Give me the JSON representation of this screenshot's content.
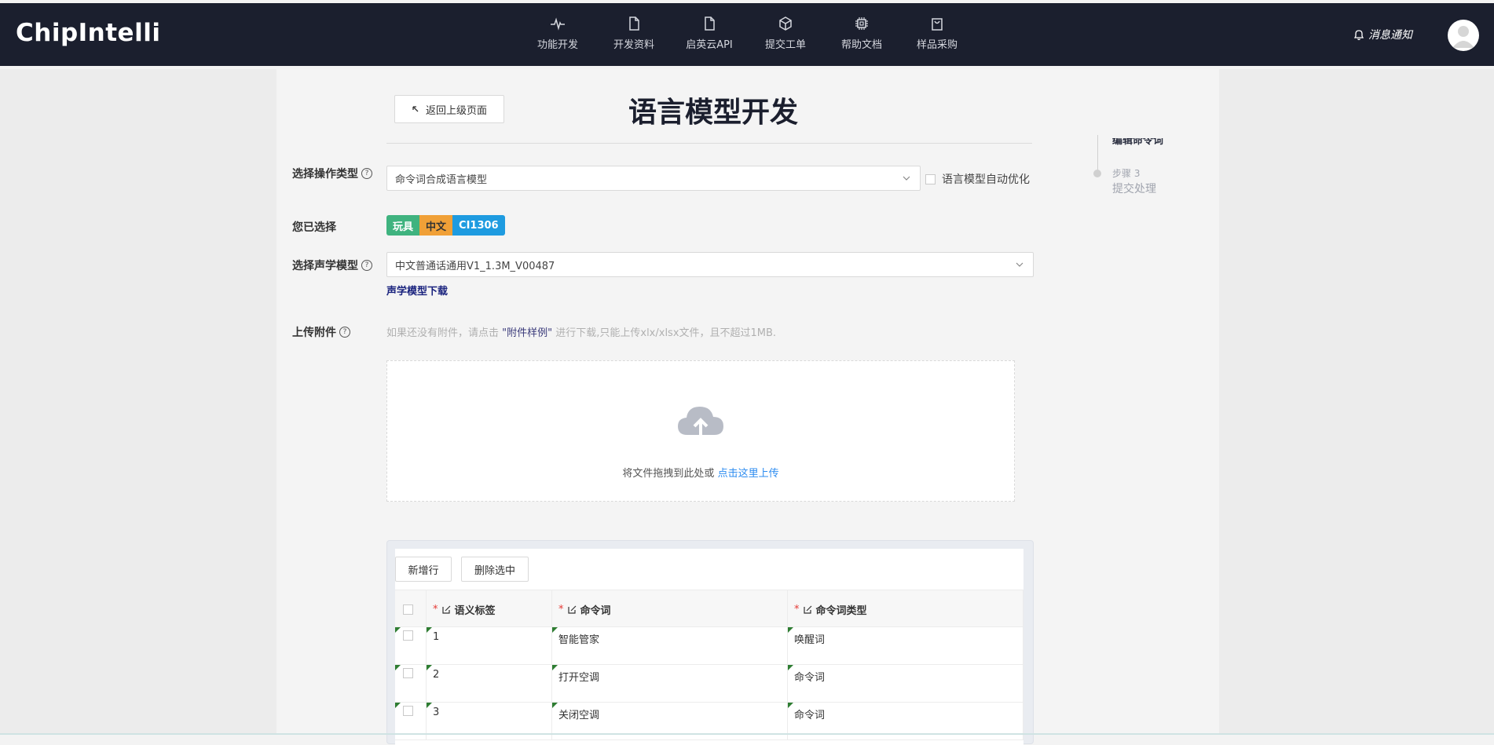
{
  "header": {
    "logo": "ChipIntelli",
    "nav": [
      {
        "label": "功能开发",
        "icon": "pulse-icon"
      },
      {
        "label": "开发资料",
        "icon": "file-icon"
      },
      {
        "label": "启英云API",
        "icon": "file-icon"
      },
      {
        "label": "提交工单",
        "icon": "cube-icon"
      },
      {
        "label": "帮助文档",
        "icon": "chip-icon"
      },
      {
        "label": "样品采购",
        "icon": "bag-icon"
      }
    ],
    "notice": "消息通知"
  },
  "page": {
    "back_label": "返回上级页面",
    "title": "语言模型开发"
  },
  "steps": {
    "partial_step": "编辑命令词",
    "step3_num": "步骤 3",
    "step3_name": "提交处理"
  },
  "form": {
    "op_type_label": "选择操作类型",
    "op_type_value": "命令词合成语言模型",
    "auto_opt_label": "语言模型自动优化",
    "selected_label": "您已选择",
    "tags": [
      {
        "text": "玩具",
        "color": "#3fb37f"
      },
      {
        "text": "中文",
        "color": "#f0a037"
      },
      {
        "text": "CI1306",
        "color": "#1e9be0"
      }
    ],
    "acoustic_label": "选择声学模型",
    "acoustic_value": "中文普通话通用V1_1.3M_V00487",
    "acoustic_download": "声学模型下载",
    "upload_label": "上传附件",
    "upload_hint_pre": "如果还没有附件，请点击 ",
    "upload_hint_link": "\"附件样例\"",
    "upload_hint_post": " 进行下载,只能上传xlx/xlsx文件，且不超过1MB.",
    "drop_text": "将文件拖拽到此处或 ",
    "drop_link": "点击这里上传"
  },
  "table": {
    "add_row": "新增行",
    "delete_selected": "删除选中",
    "columns": [
      "语义标签",
      "命令词",
      "命令词类型"
    ],
    "rows": [
      {
        "tag": "1",
        "word": "智能管家",
        "type": "唤醒词"
      },
      {
        "tag": "2",
        "word": "打开空调",
        "type": "命令词"
      },
      {
        "tag": "3",
        "word": "关闭空调",
        "type": "命令词"
      }
    ]
  }
}
